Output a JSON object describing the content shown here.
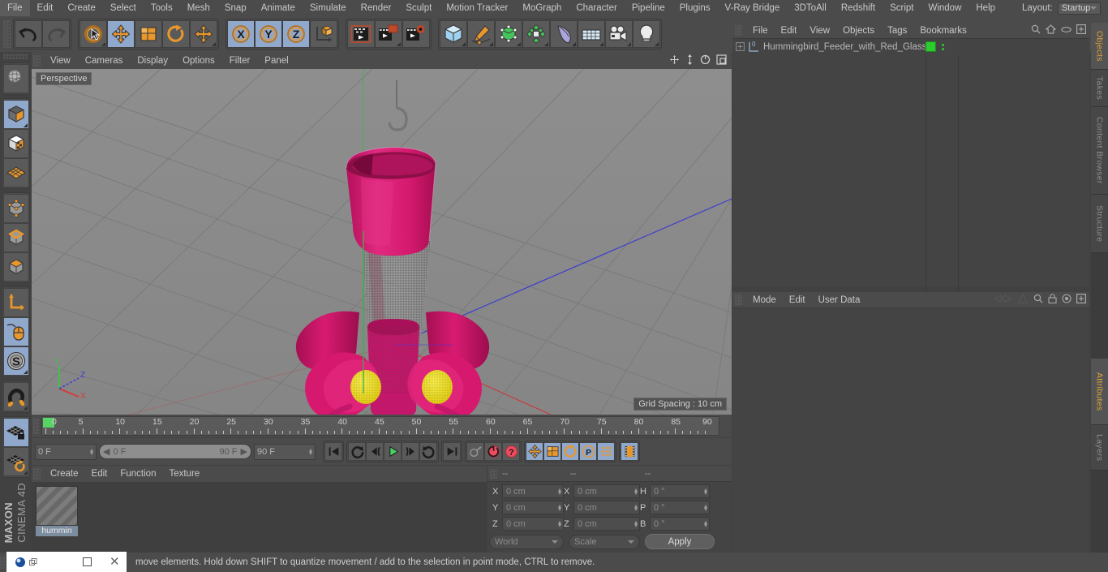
{
  "app": {
    "title": "MAXON CINEMA 4D",
    "brand_line1": "MAXON",
    "brand_line2": "CINEMA 4D"
  },
  "menubar": {
    "items": [
      {
        "label": "File"
      },
      {
        "label": "Edit"
      },
      {
        "label": "Create"
      },
      {
        "label": "Select"
      },
      {
        "label": "Tools"
      },
      {
        "label": "Mesh"
      },
      {
        "label": "Snap"
      },
      {
        "label": "Animate"
      },
      {
        "label": "Simulate"
      },
      {
        "label": "Render"
      },
      {
        "label": "Sculpt"
      },
      {
        "label": "Motion Tracker"
      },
      {
        "label": "MoGraph"
      },
      {
        "label": "Character"
      },
      {
        "label": "Pipeline"
      },
      {
        "label": "Plugins"
      },
      {
        "label": "V-Ray Bridge"
      },
      {
        "label": "3DToAll"
      },
      {
        "label": "Redshift"
      },
      {
        "label": "Script"
      },
      {
        "label": "Window"
      },
      {
        "label": "Help"
      }
    ],
    "layout_label": "Layout:",
    "layout_value": "Startup",
    "search_icon": "search-icon"
  },
  "toolbar": {
    "groups": [
      {
        "name": "history",
        "buttons": [
          {
            "name": "undo-button",
            "icon": "undo-icon",
            "active": false,
            "corner": false
          },
          {
            "name": "redo-button",
            "icon": "redo-icon",
            "active": false,
            "corner": false
          }
        ]
      },
      {
        "name": "transform",
        "buttons": [
          {
            "name": "live-selection-tool",
            "icon": "cursor-circle-icon",
            "active": false,
            "corner": true
          },
          {
            "name": "move-tool",
            "icon": "move-arrows-icon",
            "active": true,
            "corner": false
          },
          {
            "name": "scale-tool",
            "icon": "scale-box-icon",
            "active": false,
            "corner": false
          },
          {
            "name": "rotate-tool",
            "icon": "rotate-arc-icon",
            "active": false,
            "corner": false
          },
          {
            "name": "move-duplicate-tool",
            "icon": "move-arrows-icon",
            "active": false,
            "corner": true
          }
        ]
      },
      {
        "name": "axis-locks",
        "buttons": [
          {
            "name": "lock-x-axis-button",
            "icon": "x-axis-icon",
            "label": "X",
            "active": true,
            "corner": false
          },
          {
            "name": "lock-y-axis-button",
            "icon": "y-axis-icon",
            "label": "Y",
            "active": true,
            "corner": false
          },
          {
            "name": "lock-z-axis-button",
            "icon": "z-axis-icon",
            "label": "Z",
            "active": true,
            "corner": false
          },
          {
            "name": "world-object-coordinates-button",
            "icon": "world-axis-cube-icon",
            "active": false,
            "corner": false
          }
        ]
      },
      {
        "name": "render",
        "buttons": [
          {
            "name": "render-view-button",
            "icon": "render-view-icon",
            "active": false,
            "corner": false
          },
          {
            "name": "render-to-picture-viewer-button",
            "icon": "render-picture-icon",
            "active": false,
            "corner": true
          },
          {
            "name": "render-settings-button",
            "icon": "render-settings-gear-icon",
            "active": false,
            "corner": false
          }
        ]
      },
      {
        "name": "creation",
        "buttons": [
          {
            "name": "add-cube-button",
            "icon": "cube-icon",
            "active": false,
            "corner": true
          },
          {
            "name": "add-spline-button",
            "icon": "pen-spline-icon",
            "active": false,
            "corner": true
          },
          {
            "name": "add-generator-button",
            "icon": "green-cube-generator-icon",
            "active": false,
            "corner": true
          },
          {
            "name": "add-deformer-button",
            "icon": "green-cluster-icon",
            "active": false,
            "corner": true
          },
          {
            "name": "add-bend-deformer-button",
            "icon": "bend-icon",
            "active": false,
            "corner": true
          },
          {
            "name": "add-environment-button",
            "icon": "floor-grid-icon",
            "active": false,
            "corner": true
          },
          {
            "name": "add-camera-button",
            "icon": "camera-icon",
            "active": false,
            "corner": true
          },
          {
            "name": "add-light-button",
            "icon": "light-bulb-icon",
            "active": false,
            "corner": true
          }
        ]
      }
    ]
  },
  "left_toolbar": {
    "groups": [
      {
        "buttons": [
          {
            "name": "make-editable-button",
            "icon": "globe-grid-icon",
            "active": false,
            "corner": false
          }
        ]
      },
      {
        "buttons": [
          {
            "name": "model-mode-button",
            "icon": "model-cube-icon",
            "active": true,
            "corner": true
          },
          {
            "name": "texture-mode-button",
            "icon": "texture-cube-icon",
            "active": false,
            "corner": false
          },
          {
            "name": "workplane-mode-button",
            "icon": "workplane-grid-icon",
            "active": false,
            "corner": false
          }
        ]
      },
      {
        "buttons": [
          {
            "name": "points-mode-button",
            "icon": "points-cube-icon",
            "active": false,
            "corner": false
          },
          {
            "name": "edges-mode-button",
            "icon": "edges-cube-icon",
            "active": false,
            "corner": false
          },
          {
            "name": "polygons-mode-button",
            "icon": "polygons-cube-icon",
            "active": false,
            "corner": false
          }
        ]
      },
      {
        "buttons": [
          {
            "name": "enable-axis-button",
            "icon": "axis-l-icon",
            "active": false,
            "corner": false
          },
          {
            "name": "viewport-solo-button",
            "icon": "mouse-icon",
            "active": true,
            "corner": false
          },
          {
            "name": "enable-snapping-button",
            "icon": "s-circle-icon",
            "active": true,
            "corner": true
          }
        ]
      },
      {
        "buttons": [
          {
            "name": "magnet-tool-button",
            "icon": "magnet-icon",
            "active": false,
            "corner": true
          }
        ]
      },
      {
        "buttons": [
          {
            "name": "lock-workplane-button",
            "icon": "grid-lock-icon",
            "active": true,
            "corner": false
          },
          {
            "name": "workplane-rotate-button",
            "icon": "grid-rotate-icon",
            "active": false,
            "corner": true
          }
        ]
      }
    ]
  },
  "viewport": {
    "menu_items": [
      {
        "label": "View"
      },
      {
        "label": "Cameras"
      },
      {
        "label": "Display"
      },
      {
        "label": "Options"
      },
      {
        "label": "Filter"
      },
      {
        "label": "Panel"
      }
    ],
    "nav_icons": [
      {
        "name": "pan-view-icon"
      },
      {
        "name": "dolly-view-icon"
      },
      {
        "name": "rotate-view-icon"
      },
      {
        "name": "maximize-view-icon"
      }
    ],
    "perspective_label": "Perspective",
    "grid_spacing_label": "Grid Spacing : 10 cm",
    "axis_gizmo": {
      "x_label": "X",
      "y_label": "Y",
      "z_label": "Z",
      "x_color": "#d43b3b",
      "y_color": "#3ec14e",
      "z_color": "#4040d8"
    },
    "model": {
      "name": "Hummingbird_Feeder_with_Red_Glass",
      "body_color": "#d81b72",
      "body_color_dark": "#a8105a",
      "center_color": "#e8d818",
      "glass_color": "#9a9a9a"
    },
    "grid_color": "#7e7e7e",
    "background_color": "#8b8b8b"
  },
  "timeline": {
    "ticks": [
      "0",
      "5",
      "10",
      "15",
      "20",
      "25",
      "30",
      "35",
      "40",
      "45",
      "50",
      "55",
      "60",
      "65",
      "70",
      "75",
      "80",
      "85",
      "90"
    ],
    "current_frame_field": "0 F",
    "playhead_frame": "0"
  },
  "transport": {
    "current_frame": "0 F",
    "range_start": "0 F",
    "range_end": "90 F",
    "end_frame": "90 F",
    "buttons": [
      {
        "name": "go-to-start-button",
        "icon": "skip-start-icon",
        "active": false
      },
      {
        "name": "play-backwards-loop-button",
        "icon": "loop-back-icon",
        "active": false
      },
      {
        "name": "step-back-button",
        "icon": "step-back-icon",
        "active": false
      },
      {
        "name": "play-button",
        "icon": "play-icon",
        "active": false
      },
      {
        "name": "step-forward-button",
        "icon": "step-forward-icon",
        "active": false
      },
      {
        "name": "play-forward-loop-button",
        "icon": "loop-forward-icon",
        "active": false
      },
      {
        "name": "go-to-end-button",
        "icon": "skip-end-icon",
        "active": false
      },
      {
        "name": "record-active-objects-button",
        "icon": "key-icon",
        "active": false
      },
      {
        "name": "autokeying-button",
        "icon": "autokey-circle-icon",
        "active": false
      },
      {
        "name": "keyframe-selection-button",
        "icon": "question-circle-icon",
        "active": false
      },
      {
        "name": "position-key-button",
        "icon": "move-arrows-icon",
        "active": true
      },
      {
        "name": "scale-key-button",
        "icon": "scale-box-icon",
        "active": true
      },
      {
        "name": "rotation-key-button",
        "icon": "rotate-arc-icon",
        "active": true
      },
      {
        "name": "parameter-key-button",
        "icon": "p-circle-icon",
        "active": true
      },
      {
        "name": "point-level-animation-button",
        "icon": "dots-grid-icon",
        "active": true
      },
      {
        "name": "timeline-mode-button",
        "icon": "filmstrip-icon",
        "active": true
      }
    ]
  },
  "material_manager": {
    "menu_items": [
      {
        "label": "Create"
      },
      {
        "label": "Edit"
      },
      {
        "label": "Function"
      },
      {
        "label": "Texture"
      }
    ],
    "materials": [
      {
        "name": "hummin",
        "label": "hummin"
      }
    ]
  },
  "coordinates": {
    "headers": [
      "--",
      "--",
      "--"
    ],
    "rows": [
      {
        "label1": "X",
        "value1": "0 cm",
        "label2": "X",
        "value2": "0 cm",
        "label3": "H",
        "value3": "0 °"
      },
      {
        "label1": "Y",
        "value1": "0 cm",
        "label2": "Y",
        "value2": "0 cm",
        "label3": "P",
        "value3": "0 °"
      },
      {
        "label1": "Z",
        "value1": "0 cm",
        "label2": "Z",
        "value2": "0 cm",
        "label3": "B",
        "value3": "0 °"
      }
    ],
    "space_dropdown": "World",
    "mode_dropdown": "Scale",
    "apply_button": "Apply"
  },
  "object_manager": {
    "menu_items": [
      {
        "label": "File"
      },
      {
        "label": "Edit"
      },
      {
        "label": "View"
      },
      {
        "label": "Objects"
      },
      {
        "label": "Tags"
      },
      {
        "label": "Bookmarks"
      }
    ],
    "header_icons": [
      {
        "name": "search-icon"
      },
      {
        "name": "home-icon"
      },
      {
        "name": "ellipse-icon"
      },
      {
        "name": "add-panel-icon"
      }
    ],
    "rows": [
      {
        "name": "Hummingbird_Feeder_with_Red_Glass",
        "layer_color": "#2ecb2e",
        "expandable": true,
        "tag_label": "0"
      }
    ]
  },
  "attribute_manager": {
    "menu_items": [
      {
        "label": "Mode"
      },
      {
        "label": "Edit"
      },
      {
        "label": "User Data"
      }
    ],
    "header_icons": [
      {
        "name": "interpolation-icon"
      },
      {
        "name": "cone-icon"
      },
      {
        "name": "search-icon"
      },
      {
        "name": "lock-icon"
      },
      {
        "name": "target-icon"
      },
      {
        "name": "add-panel-icon"
      }
    ]
  },
  "vertical_tabs": [
    {
      "label": "Objects",
      "active": true
    },
    {
      "label": "Takes",
      "active": false
    },
    {
      "label": "Content Browser",
      "active": false
    },
    {
      "label": "Structure",
      "active": false
    },
    {
      "label": "Attributes",
      "active": true
    },
    {
      "label": "Layers",
      "active": false
    }
  ],
  "statusbar": {
    "text": "move elements. Hold down SHIFT to quantize movement / add to the selection in point mode, CTRL to remove."
  },
  "taskbar": {
    "app_icon": "cinema4d-icon",
    "restore_icon": "restore-window-icon",
    "close_icon": "close-window-icon"
  },
  "colors": {
    "accent_orange": "#e89a33",
    "panel_bg": "#444444",
    "chrome_bg": "#4b4b4b",
    "active_blue": "#8fa8cc"
  }
}
